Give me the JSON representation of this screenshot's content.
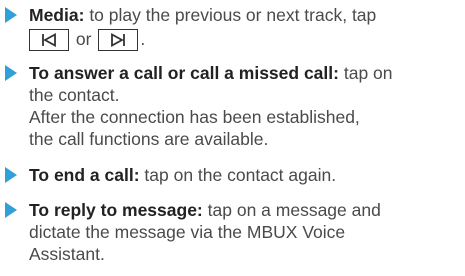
{
  "colors": {
    "arrow": "#2fa0d8",
    "text": "#4a4a4a",
    "bold": "#222222"
  },
  "items": [
    {
      "icon": "play-arrow-icon",
      "title": "Media:",
      "line1": "to play the previous or next track, tap",
      "skip_prev_icon": "skip-previous-icon",
      "or_text": "or",
      "skip_next_icon": "skip-next-icon",
      "period": "."
    },
    {
      "icon": "play-arrow-icon",
      "title": "To answer a call or call a missed call:",
      "line1_tail": "tap on",
      "line2": "the contact.",
      "line3": "After the connection has been established,",
      "line4": "the call functions are available."
    },
    {
      "icon": "play-arrow-icon",
      "title": "To end a call:",
      "line1_tail": "tap on the contact again."
    },
    {
      "icon": "play-arrow-icon",
      "title": "To reply to message:",
      "line1_tail": "tap on a message and",
      "line2": "dictate the message via the MBUX Voice",
      "line3": "Assistant."
    }
  ]
}
